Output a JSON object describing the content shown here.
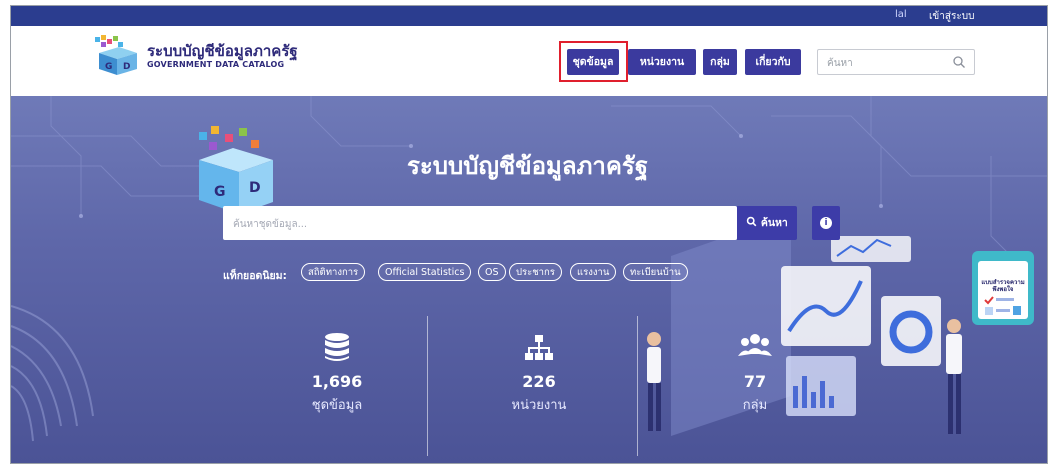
{
  "topbar": {
    "lang_icon": "lal",
    "login": "เข้าสู่ระบบ"
  },
  "brand": {
    "title": "ระบบบัญชีข้อมูลภาครัฐ",
    "subtitle": "GOVERNMENT DATA CATALOG",
    "logo_letters": [
      "G",
      "D"
    ]
  },
  "nav": {
    "items": [
      {
        "label": "ชุดข้อมูล",
        "active": true
      },
      {
        "label": "หน่วยงาน"
      },
      {
        "label": "กลุ่ม"
      },
      {
        "label": "เกี่ยวกับ"
      }
    ],
    "search_placeholder": "ค้นหา",
    "highlight_color": "#e01f2d"
  },
  "hero": {
    "title": "ระบบบัญชีข้อมูลภาครัฐ",
    "search_placeholder": "ค้นหาชุดข้อมูล...",
    "search_button": "ค้นหา",
    "info_icon": "info-icon",
    "tags_label": "แท็กยอดนิยม:",
    "tags": [
      "สถิติทางการ",
      "Official Statistics",
      "OS",
      "ประชากร",
      "แรงงาน",
      "ทะเบียนบ้าน"
    ]
  },
  "stats": [
    {
      "icon": "database-icon",
      "value": "1,696",
      "label": "ชุดข้อมูล"
    },
    {
      "icon": "sitemap-icon",
      "value": "226",
      "label": "หน่วยงาน"
    },
    {
      "icon": "users-icon",
      "value": "77",
      "label": "กลุ่ม"
    }
  ],
  "side_card": {
    "text": "แบบสำรวจความพึงพอใจ"
  },
  "colors": {
    "brand": "#2e2a7a",
    "nav_button": "#3b3a9e",
    "topbar": "#2b3d8f",
    "hero": "#5e67a9"
  }
}
